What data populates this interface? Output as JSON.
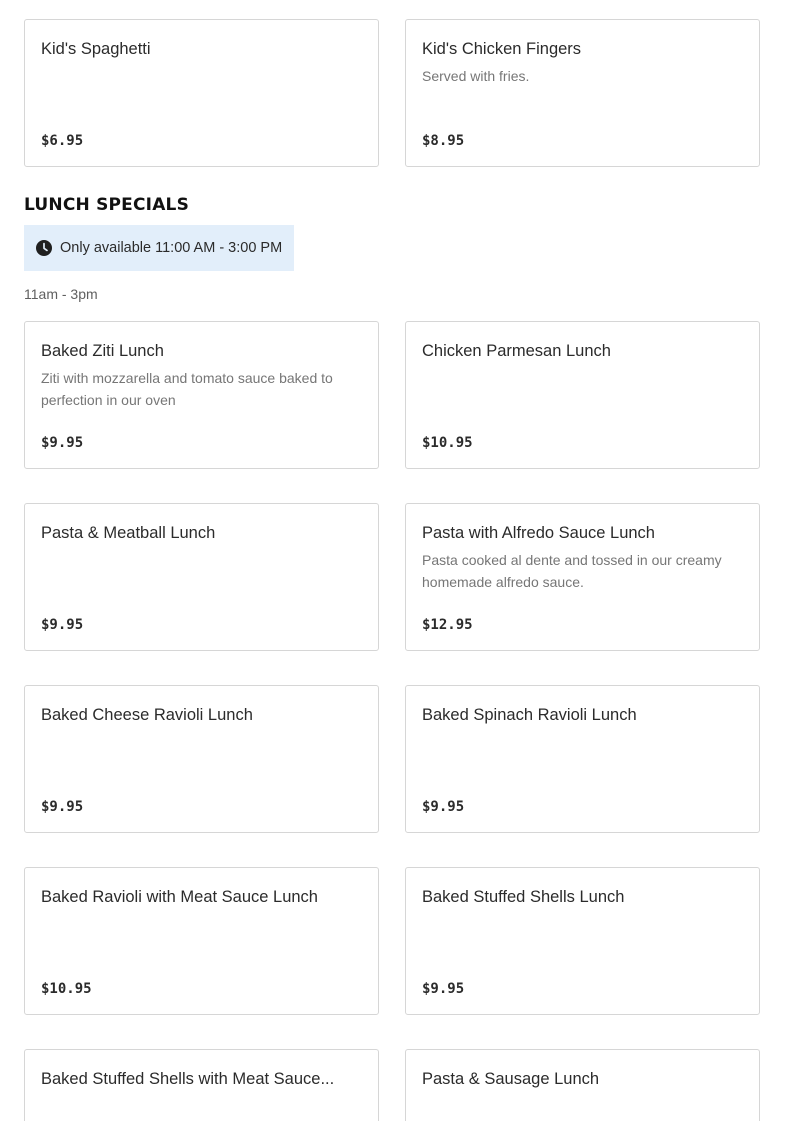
{
  "top_items": [
    {
      "name": "Kid's Spaghetti",
      "description": "",
      "price": "$6.95"
    },
    {
      "name": "Kid's Chicken Fingers",
      "description": "Served with fries.",
      "price": "$8.95"
    }
  ],
  "section": {
    "title": "LUNCH SPECIALS",
    "availability": "Only available 11:00 AM - 3:00 PM",
    "availability_icon": "clock-icon",
    "hours": "11am - 3pm"
  },
  "lunch_items": [
    {
      "name": "Baked Ziti Lunch",
      "description": "Ziti with mozzarella and tomato sauce baked to perfection in our oven",
      "price": "$9.95"
    },
    {
      "name": "Chicken Parmesan Lunch",
      "description": "",
      "price": "$10.95"
    },
    {
      "name": "Pasta & Meatball Lunch",
      "description": "",
      "price": "$9.95"
    },
    {
      "name": "Pasta with Alfredo Sauce Lunch",
      "description": "Pasta cooked al dente and tossed in our creamy homemade alfredo sauce.",
      "price": "$12.95"
    },
    {
      "name": "Baked Cheese Ravioli Lunch",
      "description": "",
      "price": "$9.95"
    },
    {
      "name": "Baked Spinach Ravioli Lunch",
      "description": "",
      "price": "$9.95"
    },
    {
      "name": "Baked Ravioli with Meat Sauce Lunch",
      "description": "",
      "price": "$10.95"
    },
    {
      "name": "Baked Stuffed Shells Lunch",
      "description": "",
      "price": "$9.95"
    },
    {
      "name": "Baked Stuffed Shells with Meat Sauce...",
      "description": "",
      "price": ""
    },
    {
      "name": "Pasta & Sausage Lunch",
      "description": "",
      "price": ""
    }
  ],
  "colors": {
    "availability_bg": "#e2eefa",
    "card_border": "#d6d6d6",
    "description_text": "#767676"
  }
}
